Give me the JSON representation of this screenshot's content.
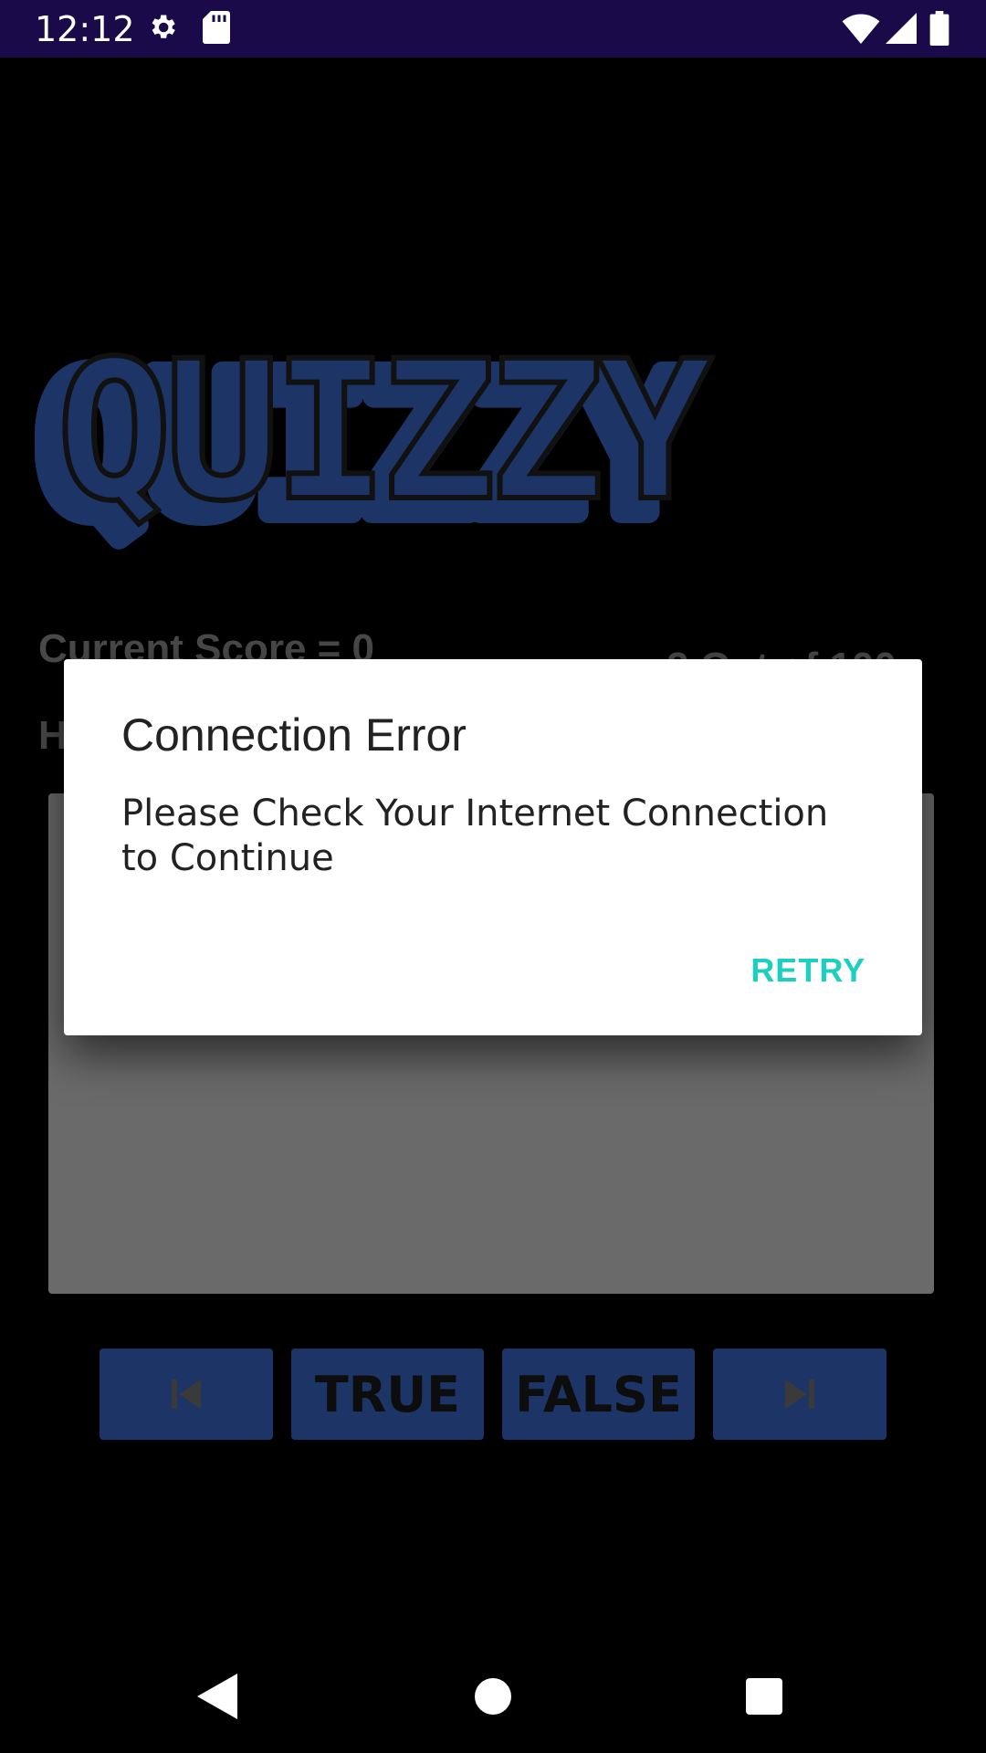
{
  "status": {
    "time": "12:12"
  },
  "app": {
    "logo_text": "QUIZZY",
    "score_label": "Current Score = 0",
    "high_label": "H",
    "question_number": "2 Out of 100",
    "buttons": {
      "true_label": "TRUE",
      "false_label": "FALSE"
    }
  },
  "dialog": {
    "title": "Connection Error",
    "message": "Please Check Your Internet Connection to Continue",
    "retry_label": "RETRY"
  },
  "colors": {
    "status_bar": "#1a0a4a",
    "accent": "#1ccfc0",
    "button": "#1d3566",
    "logo": "#1d3566"
  }
}
